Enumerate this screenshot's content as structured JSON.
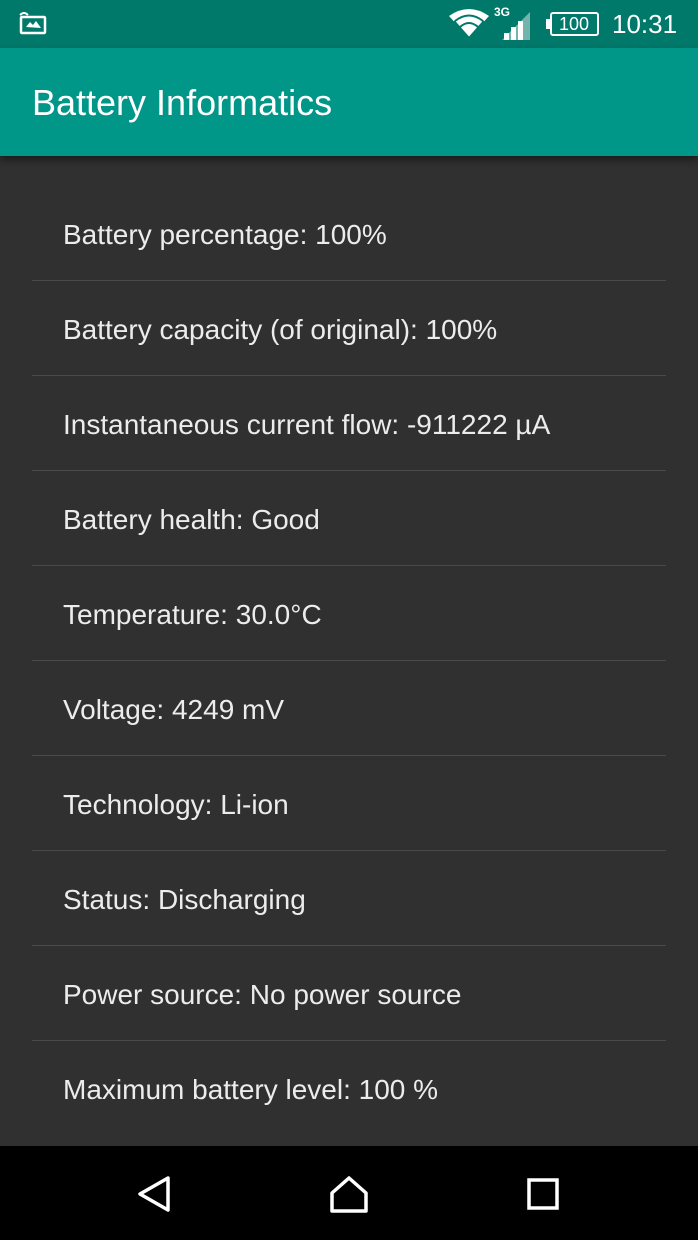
{
  "status_bar": {
    "network_type": "3G",
    "battery_level": "100",
    "time": "10:31",
    "left_icon": "screenshot-notification-icon",
    "icons": [
      "wifi-icon",
      "signal-icon",
      "battery-icon"
    ]
  },
  "app_bar": {
    "title": "Battery Informatics",
    "color": "#009688"
  },
  "items": [
    {
      "label": "Battery percentage: 100%"
    },
    {
      "label": "Battery capacity (of original): 100%"
    },
    {
      "label": "Instantaneous current flow: -911222 µA"
    },
    {
      "label": "Battery health: Good"
    },
    {
      "label": "Temperature: 30.0°C"
    },
    {
      "label": "Voltage: 4249 mV"
    },
    {
      "label": "Technology: Li-ion"
    },
    {
      "label": "Status: Discharging"
    },
    {
      "label": "Power source: No power source"
    },
    {
      "label": "Maximum battery level: 100 %"
    }
  ],
  "nav_bar": {
    "buttons": [
      "back-icon",
      "home-icon",
      "recents-icon"
    ]
  }
}
